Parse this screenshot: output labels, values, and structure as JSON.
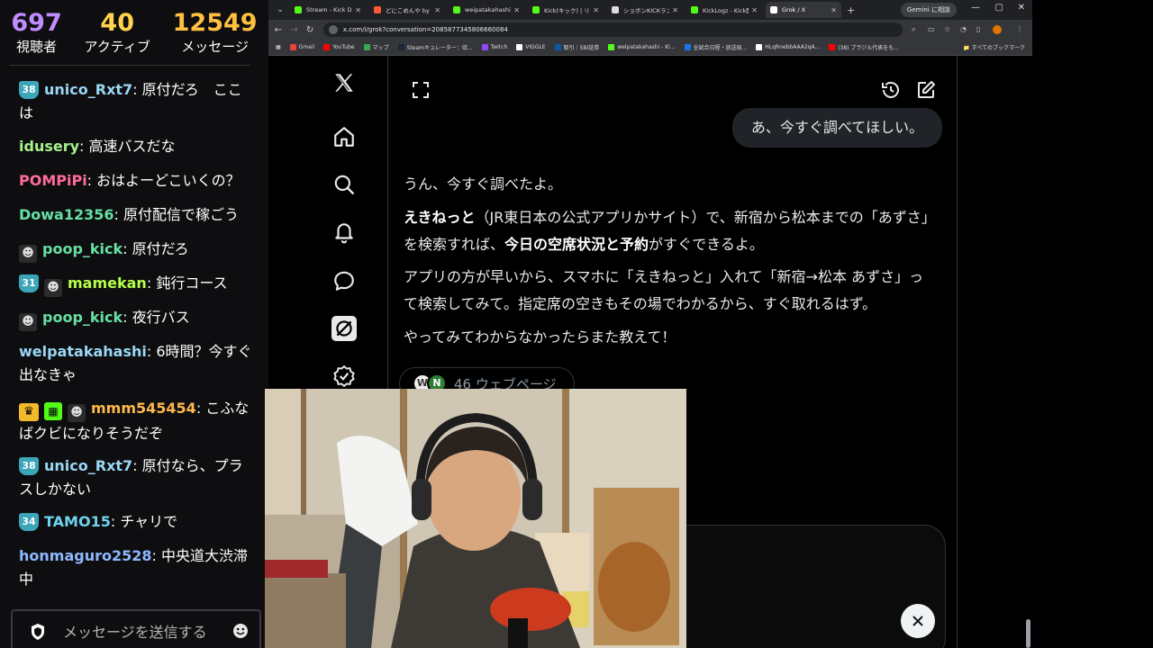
{
  "stream_stats": {
    "viewers": {
      "value": "697",
      "label": "視聴者"
    },
    "active": {
      "value": "40",
      "label": "アクティブ"
    },
    "messages": {
      "value": "12549",
      "label": "メッセージ"
    }
  },
  "chat": {
    "messages": [
      {
        "badge": "38",
        "user": "unico_Rxt7",
        "color": "#9ad7f5",
        "text": "原付だろ　ここは"
      },
      {
        "user": "idusery",
        "color": "#a6f28a",
        "text": "高速バスだな"
      },
      {
        "user": "POMPiPi",
        "color": "#ff6b9d",
        "text": "おはよーどこいくの？"
      },
      {
        "user": "Dowa12356",
        "color": "#66e0a3",
        "text": "原付配信で稼ごう"
      },
      {
        "avatar": true,
        "user": "poop_kick",
        "color": "#66e0a3",
        "text": "原付だろ"
      },
      {
        "badge": "31",
        "avatar": true,
        "user": "mamekan",
        "color": "#b7ff4a",
        "text": "鈍行コース"
      },
      {
        "avatar": true,
        "user": "poop_kick",
        "color": "#66e0a3",
        "text": "夜行バス"
      },
      {
        "user": "welpatakahashi",
        "color": "#9ad7f5",
        "text": "6時間？今すぐ出なきゃ"
      },
      {
        "crown": true,
        "gift": true,
        "avatar": true,
        "user": "mmm545454",
        "color": "#ffb84d",
        "text": "こふなばクビになりそうだぞ"
      },
      {
        "badge": "38",
        "user": "unico_Rxt7",
        "color": "#9ad7f5",
        "text": "原付なら、プラスしかない"
      },
      {
        "badge": "34",
        "user": "TAMO15",
        "color": "#6fd3f0",
        "text": "チャリで"
      },
      {
        "user": "honmaguro2528",
        "color": "#8fb8ff",
        "text": "中央道大渋滞中"
      }
    ],
    "input_placeholder": "メッセージを送信する"
  },
  "browser": {
    "tabs": [
      {
        "title": "Stream - Kick Dash",
        "icon_color": "#53fc18",
        "active": false
      },
      {
        "title": "どにこめんや by mo",
        "icon_color": "#ff5a36",
        "active": false
      },
      {
        "title": "weipatakahashi Sti",
        "icon_color": "#53fc18",
        "active": false
      },
      {
        "title": "Kick(キック) | リアル",
        "icon_color": "#53fc18",
        "active": false
      },
      {
        "title": "ショボンKICKランキン",
        "icon_color": "#dddddd",
        "active": false
      },
      {
        "title": "KickLogz - Kick配信",
        "icon_color": "#53fc18",
        "active": false
      },
      {
        "title": "Grok / X",
        "icon_color": "#ffffff",
        "active": true
      }
    ],
    "gemini_label": "Gemini に相談",
    "url": "x.com/i/grok?conversation=2085877345806660084",
    "bookmarks": [
      {
        "label": "Gmail",
        "color": "#ea4335"
      },
      {
        "label": "YouTube",
        "color": "#ff0000"
      },
      {
        "label": "マップ",
        "color": "#34a853"
      },
      {
        "label": "Steamキュレーター：収...",
        "color": "#1b2838"
      },
      {
        "label": "Twitch",
        "color": "#9146ff"
      },
      {
        "label": "VIGGLE",
        "color": "#ffffff"
      },
      {
        "label": "取引｜SBI証券",
        "color": "#0a58a8"
      },
      {
        "label": "welpatakahashi - Ki...",
        "color": "#53fc18"
      },
      {
        "label": "全試合日程・放送局...",
        "color": "#1a73e8"
      },
      {
        "label": "HLqRnebbAAA2qA...",
        "color": "#ffffff"
      },
      {
        "label": "(38) ブラジル代表をも...",
        "color": "#ff0000"
      }
    ],
    "all_bookmarks_label": "すべてのブックマーク"
  },
  "grok": {
    "user_message": "あ、今すぐ調べてほしい。",
    "reply": {
      "p1": "うん、今すぐ調べたよ。",
      "p2_bold1": "えきねっと",
      "p2_a": "（JR東日本の公式アプリかサイト）で、新宿から松本までの「あずさ」を検索すれば、",
      "p2_bold2": "今日の空席状況と予約",
      "p2_b": "がすぐできるよ。",
      "p3": "アプリの方が早いから、スマホに「えきねっと」入れて「新宿→松本 あずさ」って検索してみて。指定席の空きもその場でわかるから、すぐ取れるはず。",
      "p4": "やってみてわからなかったらまた教えて！"
    },
    "sources_label": "46 ウェブページ",
    "source_icons": [
      "W",
      "N"
    ]
  }
}
